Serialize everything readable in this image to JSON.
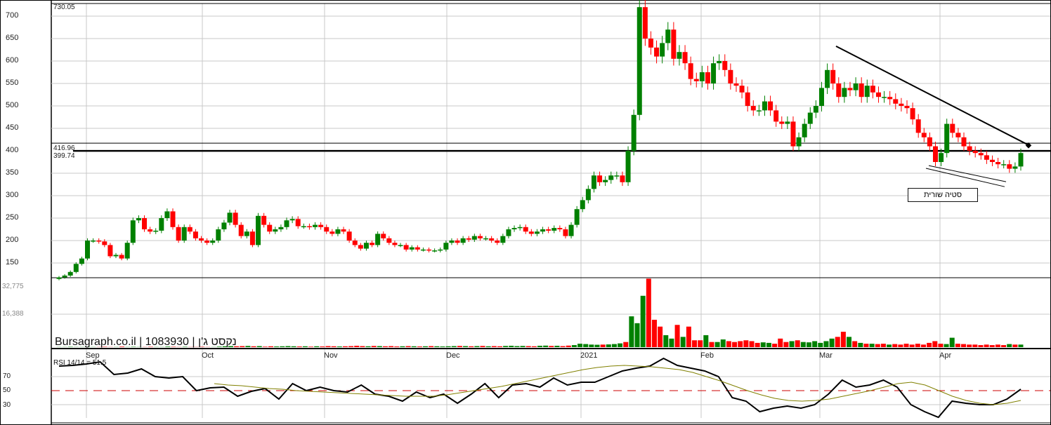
{
  "chart_data": {
    "type": "candlestick",
    "title": "Bursagraph.co.il | 1083930 | נקסט ג'ן",
    "price_axis": {
      "ticks": [
        "700",
        "650",
        "600",
        "550",
        "500",
        "450",
        "400",
        "350",
        "300",
        "250",
        "200",
        "150"
      ],
      "ylim": [
        100,
        730.05
      ]
    },
    "labels": {
      "max": "730.05",
      "level_high": "416.96",
      "level_low": "399.74"
    },
    "levels": [
      416.96,
      399.74
    ],
    "x_axis": {
      "months": [
        "Sep",
        "Oct",
        "Nov",
        "Dec",
        "2021",
        "Feb",
        "Mar",
        "Apr"
      ]
    },
    "close": [
      118,
      122,
      130,
      148,
      160,
      200,
      200,
      198,
      190,
      165,
      168,
      160,
      195,
      245,
      250,
      225,
      220,
      222,
      250,
      265,
      230,
      200,
      230,
      220,
      205,
      200,
      195,
      200,
      225,
      240,
      262,
      235,
      210,
      220,
      190,
      255,
      235,
      220,
      225,
      230,
      245,
      248,
      232,
      232,
      230,
      235,
      230,
      220,
      215,
      225,
      220,
      200,
      190,
      182,
      195,
      190,
      215,
      205,
      195,
      190,
      190,
      180,
      185,
      180,
      180,
      178,
      178,
      180,
      195,
      200,
      195,
      205,
      202,
      210,
      205,
      205,
      200,
      195,
      210,
      225,
      228,
      230,
      220,
      215,
      220,
      225,
      222,
      228,
      225,
      210,
      235,
      270,
      290,
      315,
      345,
      330,
      335,
      345,
      345,
      330,
      400,
      480,
      720,
      650,
      630,
      610,
      640,
      670,
      605,
      620,
      595,
      560,
      555,
      575,
      550,
      595,
      600,
      580,
      550,
      545,
      530,
      500,
      490,
      490,
      510,
      490,
      465,
      460,
      465,
      410,
      430,
      460,
      485,
      500,
      540,
      580,
      550,
      520,
      540,
      535,
      550,
      520,
      545,
      530,
      520,
      520,
      515,
      505,
      500,
      495,
      470,
      440,
      430,
      410,
      375,
      395,
      460,
      440,
      430,
      410,
      400,
      395,
      390,
      380,
      375,
      370,
      370,
      360,
      365,
      395
    ],
    "volume": [
      100,
      100,
      200,
      100,
      100,
      200,
      100,
      100,
      200,
      100,
      100,
      300,
      100,
      200,
      100,
      100,
      200,
      100,
      100,
      300,
      200,
      100,
      200,
      100,
      100,
      200,
      100,
      100,
      300,
      500,
      600,
      500,
      600,
      700,
      500,
      600,
      300,
      500,
      400,
      500,
      600,
      500,
      400,
      500,
      300,
      500,
      400,
      600,
      500,
      400,
      500,
      600,
      800,
      600,
      500,
      700,
      600,
      500,
      600,
      400,
      500,
      600,
      500,
      400,
      500,
      600,
      500,
      400,
      500,
      600,
      700,
      600,
      500,
      600,
      700,
      500,
      600,
      500,
      700,
      800,
      600,
      700,
      600,
      500,
      800,
      900,
      700,
      800,
      600,
      900,
      1200,
      2000,
      1800,
      1500,
      1400,
      1500,
      1600,
      1800,
      2200,
      3000,
      18000,
      14000,
      30000,
      40000,
      16000,
      12000,
      7000,
      5000,
      13000,
      6000,
      12000,
      4000,
      4000,
      7000,
      3000,
      3000,
      4500,
      3500,
      3000,
      3500,
      4000,
      3500,
      2500,
      2800,
      2500,
      2000,
      5000,
      3000,
      3500,
      4000,
      3000,
      2800,
      3500,
      2500,
      3500,
      5000,
      6000,
      9000,
      6000,
      3500,
      2500,
      2000,
      2000,
      1800,
      2000,
      1500,
      1800,
      1500,
      2000,
      1500,
      2000,
      1500,
      2500,
      3500,
      2000,
      1800,
      5500,
      2000,
      1800,
      1500,
      1500,
      1200,
      1500,
      1200,
      1500,
      1200,
      1800,
      1500,
      1500
    ],
    "volume_axis": {
      "ticks": [
        "32,775",
        "16,388"
      ],
      "values": [
        32775,
        16388
      ]
    },
    "rsi": {
      "label": "RSI 14/14 = 51.5",
      "ticks": [
        "70",
        "50",
        "30"
      ],
      "values": [
        85,
        86,
        88,
        91,
        73,
        75,
        81,
        70,
        68,
        70,
        50,
        54,
        55,
        42,
        49,
        53,
        38,
        60,
        50,
        55,
        50,
        48,
        58,
        45,
        42,
        35,
        48,
        40,
        45,
        32,
        45,
        60,
        40,
        58,
        60,
        55,
        68,
        58,
        62,
        62,
        70,
        78,
        82,
        85,
        96,
        86,
        82,
        78,
        70,
        40,
        35,
        20,
        25,
        28,
        25,
        30,
        45,
        65,
        55,
        58,
        65,
        55,
        30,
        20,
        12,
        35,
        32,
        30,
        30,
        38,
        52
      ],
      "ma_values": [
        60,
        58,
        57,
        55,
        53,
        52,
        50,
        49,
        48,
        47,
        46,
        45,
        44,
        43,
        42,
        42,
        42,
        44,
        47,
        50,
        53,
        56,
        60,
        64,
        68,
        72,
        76,
        80,
        83,
        85,
        86,
        85,
        84,
        82,
        80,
        76,
        70,
        64,
        57,
        50,
        44,
        39,
        36,
        35,
        36,
        38,
        42,
        46,
        50,
        55,
        60,
        62,
        58,
        50,
        42,
        36,
        32,
        30,
        32,
        36
      ]
    },
    "annotations": [
      {
        "text": "סטיה שורית"
      }
    ],
    "colors": {
      "up": "#008000",
      "down": "#ff0000",
      "grid": "#c0c0c0",
      "rsi_ma": "#808000",
      "midline": "#cc0000"
    }
  }
}
